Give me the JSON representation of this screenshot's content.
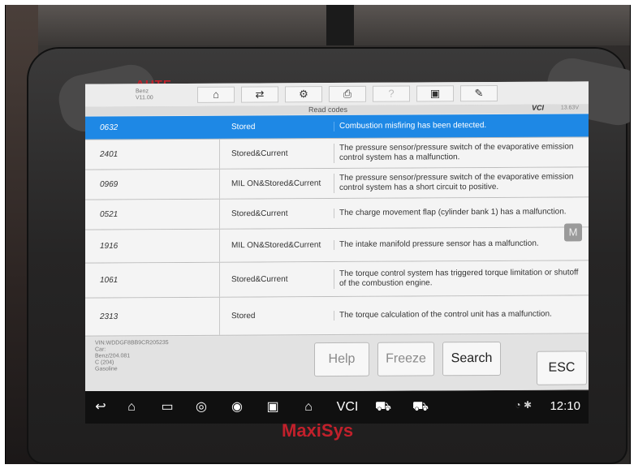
{
  "toolbar": {
    "make": "Benz",
    "version": "V11.00",
    "buttons": [
      {
        "icon": "home-icon",
        "glyph": "⌂"
      },
      {
        "icon": "vehicle-swap-icon",
        "glyph": "⇄"
      },
      {
        "icon": "settings-icon",
        "glyph": "⚙"
      },
      {
        "icon": "print-icon",
        "glyph": "⎙"
      },
      {
        "icon": "help-icon",
        "glyph": "?"
      },
      {
        "icon": "save-icon",
        "glyph": "▣"
      },
      {
        "icon": "edit-icon",
        "glyph": "✎"
      }
    ]
  },
  "subbar": {
    "title": "Read codes",
    "vci": "VCI",
    "voltage": "13.63V"
  },
  "codes": [
    {
      "code": "0632",
      "status": "Stored",
      "desc": "Combustion misfiring has been detected.",
      "selected": true
    },
    {
      "code": "2401",
      "status": "Stored&Current",
      "desc": "The pressure sensor/pressure switch of the evaporative emission control system has a malfunction.",
      "selected": false
    },
    {
      "code": "0969",
      "status": "MIL ON&Stored&Current",
      "desc": "The pressure sensor/pressure switch of the evaporative emission control system has a short circuit to positive.",
      "selected": false
    },
    {
      "code": "0521",
      "status": "Stored&Current",
      "desc": "The charge movement flap (cylinder bank 1) has a malfunction.",
      "selected": false
    },
    {
      "code": "1916",
      "status": "MIL ON&Stored&Current",
      "desc": "The intake manifold pressure sensor has a malfunction.",
      "selected": false
    },
    {
      "code": "1061",
      "status": "Stored&Current",
      "desc": "The torque control system has triggered torque limitation or shutoff of the combustion engine.",
      "selected": false
    },
    {
      "code": "2313",
      "status": "Stored",
      "desc": "The torque calculation of the control unit has a malfunction.",
      "selected": false
    }
  ],
  "vehicle_info": {
    "vin": "VIN:WDDGF8BB9CR205235",
    "car_label": "Car:",
    "model": "Benz/204.081",
    "body": "C (204)",
    "fuel": "Gasoline"
  },
  "footer_buttons": {
    "help": "Help",
    "freeze": "Freeze",
    "search": "Search",
    "esc": "ESC"
  },
  "side_badge": "M",
  "status_bar": {
    "time": "12:10"
  },
  "navbar_icons": [
    "back-icon",
    "home-icon",
    "recent-apps-icon",
    "chrome-icon",
    "camera-icon",
    "screen-record-icon",
    "maxisys-home-icon",
    "vci-icon",
    "car-icon",
    "car-user-icon"
  ],
  "brand": {
    "top": "AUTE",
    "bottom": "MaxiSys"
  }
}
